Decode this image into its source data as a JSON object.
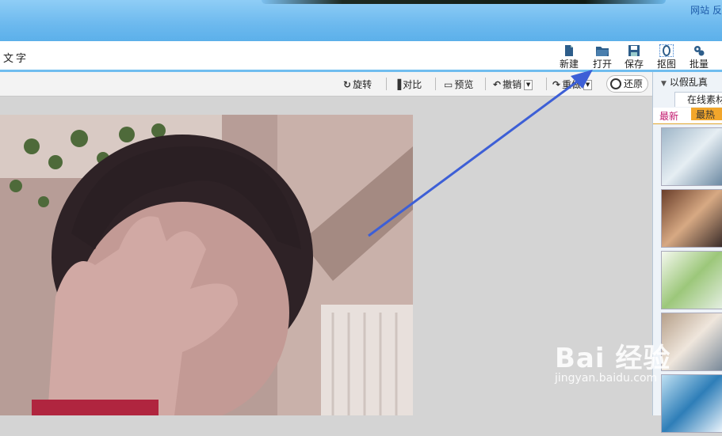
{
  "header": {
    "top_links": "网站 反"
  },
  "menu": {
    "left_label": "文字"
  },
  "toolbar": {
    "new_label": "新建",
    "open_label": "打开",
    "save_label": "保存",
    "cutout_label": "抠图",
    "batch_label": "批量"
  },
  "edit_toolbar": {
    "rotate": "旋转",
    "contrast": "对比",
    "preview": "预览",
    "undo": "撤销",
    "redo": "重做",
    "restore": "还原"
  },
  "right_panel": {
    "header": "以假乱真",
    "tab": "在线素材",
    "sub_new": "最新",
    "sub_hot": "最热"
  },
  "watermark": {
    "logo": "Bai 经验",
    "url": "jingyan.baidu.com"
  },
  "annotation": {
    "arrow_color": "#3d5fd6"
  }
}
